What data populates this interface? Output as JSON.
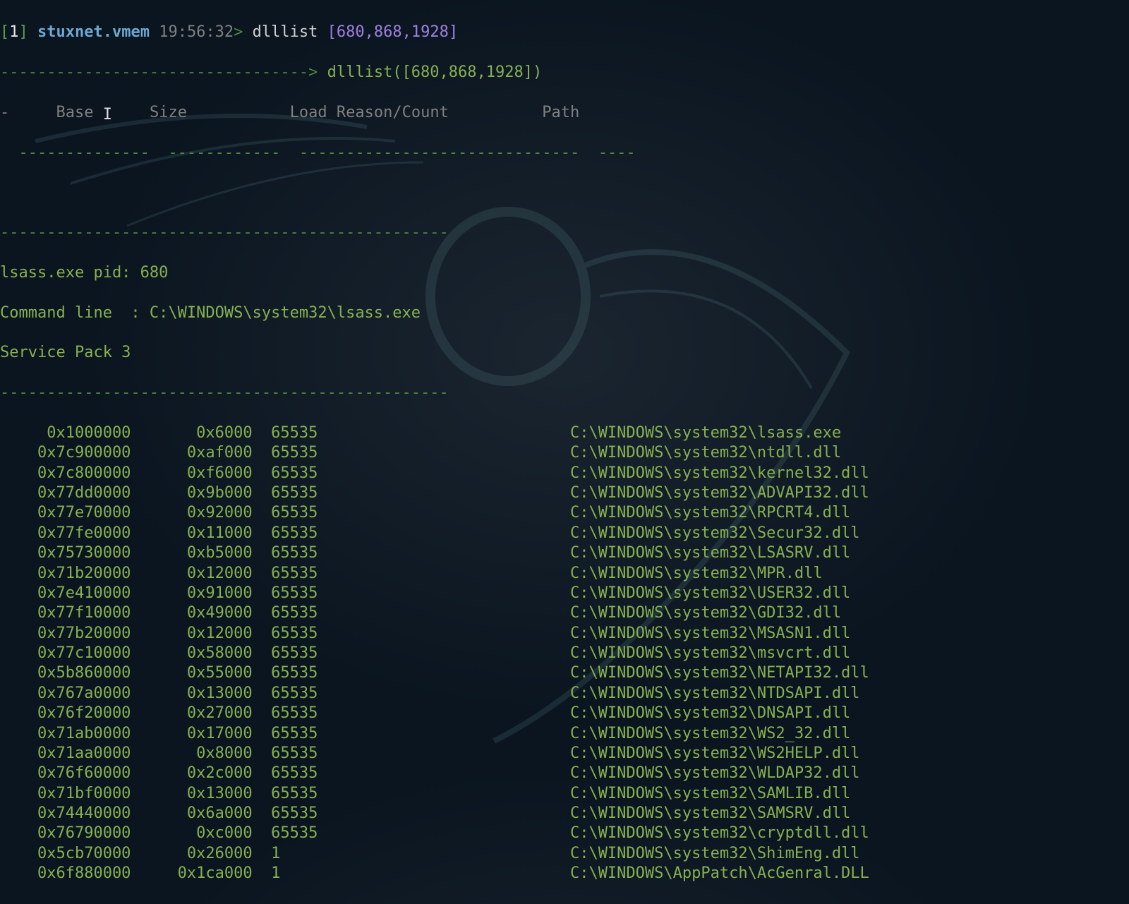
{
  "prompt": {
    "bracket_num": "1",
    "host": "stuxnet.vmem",
    "time": "19:56:32",
    "command": "dlllist",
    "pids": "[680,868,1928]",
    "echo_line": "dlllist([680,868,1928])"
  },
  "headers": {
    "dash_lead": "-",
    "base": "Base",
    "size": "Size",
    "reason": "Load Reason/Count",
    "path": "Path"
  },
  "process": {
    "pid_line": "lsass.exe pid: 680",
    "cmd_line": "Command line  : C:\\WINDOWS\\system32\\lsass.exe",
    "sp_line": "Service Pack 3"
  },
  "dashes": {
    "top": "--------------------------------->",
    "header_under": "  --------------  ------------  ------------------------------  ----",
    "sep1": "------------------------------------------------",
    "sep2": "------------------------------------------------"
  },
  "rows": [
    {
      "base": "0x1000000",
      "size": "0x6000",
      "count": "65535",
      "path": "C:\\WINDOWS\\system32\\lsass.exe"
    },
    {
      "base": "0x7c900000",
      "size": "0xaf000",
      "count": "65535",
      "path": "C:\\WINDOWS\\system32\\ntdll.dll"
    },
    {
      "base": "0x7c800000",
      "size": "0xf6000",
      "count": "65535",
      "path": "C:\\WINDOWS\\system32\\kernel32.dll"
    },
    {
      "base": "0x77dd0000",
      "size": "0x9b000",
      "count": "65535",
      "path": "C:\\WINDOWS\\system32\\ADVAPI32.dll"
    },
    {
      "base": "0x77e70000",
      "size": "0x92000",
      "count": "65535",
      "path": "C:\\WINDOWS\\system32\\RPCRT4.dll"
    },
    {
      "base": "0x77fe0000",
      "size": "0x11000",
      "count": "65535",
      "path": "C:\\WINDOWS\\system32\\Secur32.dll"
    },
    {
      "base": "0x75730000",
      "size": "0xb5000",
      "count": "65535",
      "path": "C:\\WINDOWS\\system32\\LSASRV.dll"
    },
    {
      "base": "0x71b20000",
      "size": "0x12000",
      "count": "65535",
      "path": "C:\\WINDOWS\\system32\\MPR.dll"
    },
    {
      "base": "0x7e410000",
      "size": "0x91000",
      "count": "65535",
      "path": "C:\\WINDOWS\\system32\\USER32.dll"
    },
    {
      "base": "0x77f10000",
      "size": "0x49000",
      "count": "65535",
      "path": "C:\\WINDOWS\\system32\\GDI32.dll"
    },
    {
      "base": "0x77b20000",
      "size": "0x12000",
      "count": "65535",
      "path": "C:\\WINDOWS\\system32\\MSASN1.dll"
    },
    {
      "base": "0x77c10000",
      "size": "0x58000",
      "count": "65535",
      "path": "C:\\WINDOWS\\system32\\msvcrt.dll"
    },
    {
      "base": "0x5b860000",
      "size": "0x55000",
      "count": "65535",
      "path": "C:\\WINDOWS\\system32\\NETAPI32.dll"
    },
    {
      "base": "0x767a0000",
      "size": "0x13000",
      "count": "65535",
      "path": "C:\\WINDOWS\\system32\\NTDSAPI.dll"
    },
    {
      "base": "0x76f20000",
      "size": "0x27000",
      "count": "65535",
      "path": "C:\\WINDOWS\\system32\\DNSAPI.dll"
    },
    {
      "base": "0x71ab0000",
      "size": "0x17000",
      "count": "65535",
      "path": "C:\\WINDOWS\\system32\\WS2_32.dll"
    },
    {
      "base": "0x71aa0000",
      "size": "0x8000",
      "count": "65535",
      "path": "C:\\WINDOWS\\system32\\WS2HELP.dll"
    },
    {
      "base": "0x76f60000",
      "size": "0x2c000",
      "count": "65535",
      "path": "C:\\WINDOWS\\system32\\WLDAP32.dll"
    },
    {
      "base": "0x71bf0000",
      "size": "0x13000",
      "count": "65535",
      "path": "C:\\WINDOWS\\system32\\SAMLIB.dll"
    },
    {
      "base": "0x74440000",
      "size": "0x6a000",
      "count": "65535",
      "path": "C:\\WINDOWS\\system32\\SAMSRV.dll"
    },
    {
      "base": "0x76790000",
      "size": "0xc000",
      "count": "65535",
      "path": "C:\\WINDOWS\\system32\\cryptdll.dll"
    },
    {
      "base": "0x5cb70000",
      "size": "0x26000",
      "count": "1",
      "path": "C:\\WINDOWS\\system32\\ShimEng.dll"
    },
    {
      "base": "0x6f880000",
      "size": "0x1ca000",
      "count": "1",
      "path": "C:\\WINDOWS\\AppPatch\\AcGenral.DLL"
    }
  ]
}
